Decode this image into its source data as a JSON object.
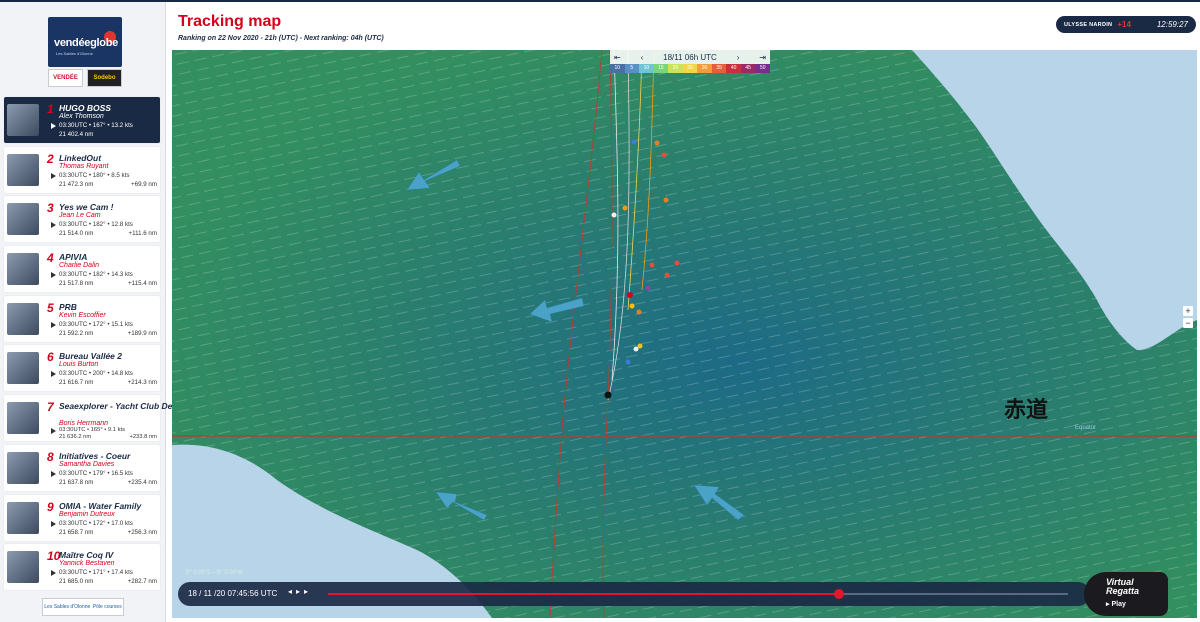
{
  "header": {
    "title": "Tracking map",
    "ranking_info": "Ranking on 22 Nov 2020 - 21h (UTC)  -  Next ranking: 04h (UTC)",
    "sponsor": "ULYSSE NARDIN",
    "timezone": "+14",
    "clock": "12:59:27"
  },
  "brand": {
    "logo_text": "vendéeglobe",
    "logo_sub": "Les Sables d'Olonne",
    "partner_1": "VENDÉE",
    "partner_2": "Sodebo",
    "footer_1": "Les Sables d'Olonne",
    "footer_2": "Pôle courses"
  },
  "ranking": [
    {
      "rank": "1",
      "boat": "HUGO BOSS",
      "skipper": "Alex Thomson",
      "line1": "03:30UTC • 167° • 13.2 kts",
      "line2": "21 402.4 nm",
      "delta": "",
      "active": true
    },
    {
      "rank": "2",
      "boat": "LinkedOut",
      "skipper": "Thomas Ruyant",
      "line1": "03:30UTC • 180° • 8.5 kts",
      "line2": "21 472.3 nm",
      "delta": "+69.9 nm"
    },
    {
      "rank": "3",
      "boat": "Yes we Cam !",
      "skipper": "Jean Le Cam",
      "line1": "03:30UTC • 182° • 12.8 kts",
      "line2": "21 514.0 nm",
      "delta": "+111.6 nm"
    },
    {
      "rank": "4",
      "boat": "APIVIA",
      "skipper": "Charlie Dalin",
      "line1": "03:30UTC • 182° • 14.3 kts",
      "line2": "21 517.8 nm",
      "delta": "+115.4 nm"
    },
    {
      "rank": "5",
      "boat": "PRB",
      "skipper": "Kevin Escoffier",
      "line1": "03:30UTC • 172° • 15.1 kts",
      "line2": "21 592.2 nm",
      "delta": "+189.9 nm"
    },
    {
      "rank": "6",
      "boat": "Bureau Vallée 2",
      "skipper": "Louis Burton",
      "line1": "03:30UTC • 200° • 14.8 kts",
      "line2": "21 616.7 nm",
      "delta": "+214.3 nm"
    },
    {
      "rank": "7",
      "boat": "Seaexplorer - Yacht Club De Monaco",
      "skipper": "Boris Herrmann",
      "line1": "03:30UTC • 165° • 9.1 kts",
      "line2": "21 636.2 nm",
      "delta": "+233.8 nm",
      "two_line": true
    },
    {
      "rank": "8",
      "boat": "Initiatives - Coeur",
      "skipper": "Samantha Davies",
      "line1": "03:30UTC • 179° • 16.5 kts",
      "line2": "21 637.8 nm",
      "delta": "+235.4 nm"
    },
    {
      "rank": "9",
      "boat": "OMIA - Water Family",
      "skipper": "Benjamin Dutreux",
      "line1": "03:30UTC • 172° • 17.0 kts",
      "line2": "21 658.7 nm",
      "delta": "+256.3 nm"
    },
    {
      "rank": "10",
      "boat": "Maître Coq IV",
      "skipper": "Yannick Bestaven",
      "line1": "03:30UTC • 171° • 17.4 kts",
      "line2": "21 685.0 nm",
      "delta": "+282.7 nm"
    }
  ],
  "map": {
    "time_label": "18/11 06h UTC",
    "nav_first": "⇤",
    "nav_prev": "‹",
    "nav_next": "›",
    "nav_last": "⇥",
    "scale": [
      "10",
      "5",
      "10",
      "15",
      "20",
      "25",
      "30",
      "35",
      "40",
      "45",
      "50"
    ],
    "equator_label": "赤道",
    "equator_small": "Equator",
    "coord_readout": "0° 0.00'S – 0° 0.00'W",
    "zoom_in": "+",
    "zoom_out": "−",
    "colors": {
      "ocean_green": "#2f8a68",
      "ocean_blue": "#1f6b8a",
      "land": "#b8d4e8",
      "track_red": "#c0392b",
      "arrow": "#4aa3c7"
    }
  },
  "playback": {
    "date": "18 / 11 /20 07:45:56 UTC",
    "prev": "◂",
    "play": "▸",
    "next": "▸",
    "progress": 0.69
  },
  "virtual_regatta": {
    "title": "Virtual Regatta",
    "play": "▸ Play"
  }
}
